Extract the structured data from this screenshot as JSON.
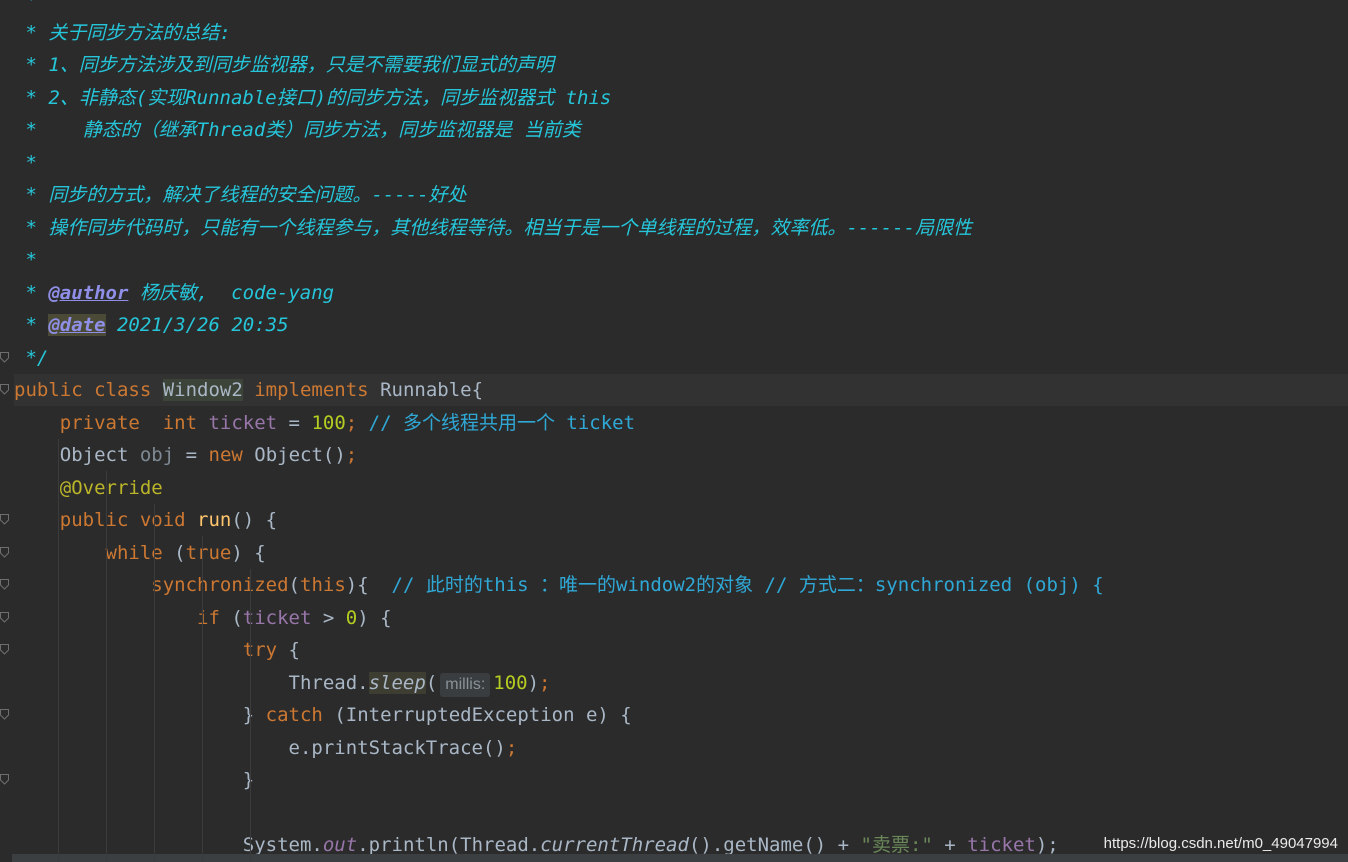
{
  "editor": {
    "lines": [
      [
        {
          "t": " *",
          "c": "t-doc"
        }
      ],
      [
        {
          "t": " * 关于同步方法的总结:",
          "c": "t-doc"
        }
      ],
      [
        {
          "t": " * 1、同步方法涉及到同步监视器，只是不需要我们显式的声明",
          "c": "t-doc"
        }
      ],
      [
        {
          "t": " * 2、非静态(实现Runnable接口)的同步方法，同步监视器式 this",
          "c": "t-doc"
        }
      ],
      [
        {
          "t": " *    静态的（继承Thread类）同步方法，同步监视器是 当前类",
          "c": "t-doc"
        }
      ],
      [
        {
          "t": " *",
          "c": "t-doc"
        }
      ],
      [
        {
          "t": " * 同步的方式，解决了线程的安全问题。-----好处",
          "c": "t-doc"
        }
      ],
      [
        {
          "t": " * 操作同步代码时，只能有一个线程参与，其他线程等待。相当于是一个单线程的过程，效率低。------局限性",
          "c": "t-doc"
        }
      ],
      [
        {
          "t": " *",
          "c": "t-doc"
        }
      ],
      [
        {
          "t": " * ",
          "c": "t-doc"
        },
        {
          "t": "@author",
          "c": "t-tag"
        },
        {
          "t": " 杨庆敏,  code-yang",
          "c": "t-doc"
        }
      ],
      [
        {
          "t": " * ",
          "c": "t-doc"
        },
        {
          "t": "@date",
          "c": "t-tag t-tagbg"
        },
        {
          "t": " 2021/3/26 20:35",
          "c": "t-doc"
        }
      ],
      [
        {
          "t": " */",
          "c": "t-doc"
        }
      ],
      [
        {
          "t": "public class ",
          "c": "t-kw"
        },
        {
          "t": "Window2",
          "c": "t-plain t-cls-hl"
        },
        {
          "t": " implements ",
          "c": "t-kw"
        },
        {
          "t": "Runnable{",
          "c": "t-plain"
        }
      ],
      [
        {
          "t": "    private  int ",
          "c": "t-kw"
        },
        {
          "t": "ticket",
          "c": "t-field"
        },
        {
          "t": " = ",
          "c": "t-plain"
        },
        {
          "t": "100",
          "c": "t-num"
        },
        {
          "t": "; ",
          "c": "t-kw"
        },
        {
          "t": "// 多个线程共用一个 ticket",
          "c": "t-cmt"
        }
      ],
      [
        {
          "t": "    Object ",
          "c": "t-plain"
        },
        {
          "t": "obj",
          "c": "t-gray"
        },
        {
          "t": " = ",
          "c": "t-plain"
        },
        {
          "t": "new ",
          "c": "t-kw"
        },
        {
          "t": "Object()",
          "c": "t-plain"
        },
        {
          "t": ";",
          "c": "t-kw"
        }
      ],
      [
        {
          "t": "    @Override",
          "c": "t-ann"
        }
      ],
      [
        {
          "t": "    public void ",
          "c": "t-kw"
        },
        {
          "t": "run",
          "c": "t-fn"
        },
        {
          "t": "() {",
          "c": "t-plain"
        }
      ],
      [
        {
          "t": "        while ",
          "c": "t-kw"
        },
        {
          "t": "(",
          "c": "t-plain"
        },
        {
          "t": "true",
          "c": "t-kw"
        },
        {
          "t": ") {",
          "c": "t-plain"
        }
      ],
      [
        {
          "t": "            synchronized",
          "c": "t-kw"
        },
        {
          "t": "(",
          "c": "t-plain"
        },
        {
          "t": "this",
          "c": "t-kw"
        },
        {
          "t": "){  ",
          "c": "t-plain"
        },
        {
          "t": "// 此时的this ：唯一的window2的对象 // 方式二：synchronized (obj) {",
          "c": "t-cmt"
        }
      ],
      [
        {
          "t": "                if ",
          "c": "t-kw"
        },
        {
          "t": "(",
          "c": "t-plain"
        },
        {
          "t": "ticket",
          "c": "t-field"
        },
        {
          "t": " > ",
          "c": "t-plain"
        },
        {
          "t": "0",
          "c": "t-num"
        },
        {
          "t": ") {",
          "c": "t-plain"
        }
      ],
      [
        {
          "t": "                    try ",
          "c": "t-kw"
        },
        {
          "t": "{",
          "c": "t-plain"
        }
      ],
      [
        {
          "t": "                        Thread.",
          "c": "t-plain"
        },
        {
          "t": "sleep",
          "c": "t-plain t-sleep"
        },
        {
          "t": "(",
          "c": "t-plain"
        },
        {
          "hint": "millis:"
        },
        {
          "t": "100",
          "c": "t-num"
        },
        {
          "t": ")",
          "c": "t-plain"
        },
        {
          "t": ";",
          "c": "t-kw"
        }
      ],
      [
        {
          "t": "                    } ",
          "c": "t-plain"
        },
        {
          "t": "catch ",
          "c": "t-kw"
        },
        {
          "t": "(InterruptedException e) {",
          "c": "t-plain"
        }
      ],
      [
        {
          "t": "                        e.printStackTrace()",
          "c": "t-plain"
        },
        {
          "t": ";",
          "c": "t-kw"
        }
      ],
      [
        {
          "t": "                    }",
          "c": "t-plain"
        }
      ],
      [],
      [
        {
          "t": "                    System.",
          "c": "t-plain"
        },
        {
          "t": "out",
          "c": "t-static"
        },
        {
          "t": ".println(Thread.",
          "c": "t-plain"
        },
        {
          "t": "currentThread",
          "c": "t-plain t-italic"
        },
        {
          "t": "().getName() + ",
          "c": "t-plain"
        },
        {
          "t": "\"卖票:\"",
          "c": "t-str"
        },
        {
          "t": " + ",
          "c": "t-plain"
        },
        {
          "t": "ticket",
          "c": "t-field"
        },
        {
          "t": ");",
          "c": "t-plain"
        }
      ]
    ]
  },
  "watermark": "https://blog.csdn.net/m0_49047994",
  "colors": {
    "background": "#2b2b2b",
    "doc_comment": "#26c6da",
    "keyword": "#cc7832",
    "field": "#9876aa",
    "number": "#b5cc21",
    "annotation": "#bbb529",
    "method": "#ffc66d"
  }
}
